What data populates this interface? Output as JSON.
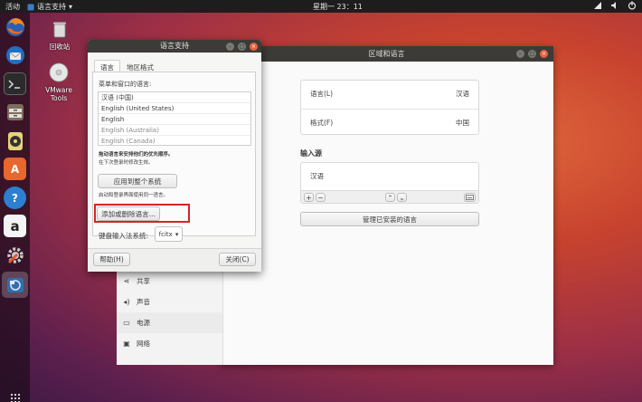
{
  "topbar": {
    "activities": "活动",
    "app_name": "语言支持",
    "app_arrow": "▾",
    "clock": "星期一 23：11",
    "tray_icons": [
      "network-icon",
      "volume-icon",
      "power-icon"
    ]
  },
  "dock": {
    "apps": [
      "firefox-icon",
      "thunderbird-icon",
      "terminal-icon",
      "files-icon",
      "rhythmbox-icon",
      "software-center-icon",
      "help-icon",
      "amazon-icon",
      "settings-icon",
      "language-support-icon"
    ],
    "amazon_label": "a",
    "help_label": "?",
    "software_label": "A"
  },
  "desktop": {
    "trash_label": "回收站",
    "vmware_label": "VMware Tools"
  },
  "region_window": {
    "title": "区域和语言",
    "language_label": "语言(L)",
    "language_value": "汉语",
    "formats_label": "格式(F)",
    "formats_value": "中国",
    "input_sources_heading": "输入源",
    "input_source_item": "汉语",
    "add_symbol": "+",
    "remove_symbol": "−",
    "up_symbol": "⌃",
    "down_symbol": "⌄",
    "manage_button": "管理已安装的语言"
  },
  "settings_list": [
    {
      "icon": "share-icon",
      "glyph": "⋖",
      "label": "共享"
    },
    {
      "icon": "sound-icon",
      "glyph": "◂)",
      "label": "声音"
    },
    {
      "icon": "power-icon",
      "glyph": "▭",
      "label": "电源"
    },
    {
      "icon": "network-icon",
      "glyph": "▣",
      "label": "网络"
    }
  ],
  "dialog": {
    "title": "语言支持",
    "tab_language": "语言",
    "tab_regional": "地区格式",
    "menus_label": "菜单和窗口的语言:",
    "languages": [
      "汉语 (中国)",
      "English (United States)",
      "English",
      "English (Australia)",
      "English (Canada)"
    ],
    "hint_bold": "拖动语言来安排他们的优先顺序。",
    "hint_sub": "在下次登录时修改生效。",
    "apply_button": "应用到整个系统",
    "apply_hint": "启动和登录界面使用同一语言。",
    "add_remove_button": "添加或删除语言...",
    "keyboard_label": "键盘输入法系统:",
    "keyboard_value": "fcitx",
    "help_button": "帮助(H)",
    "close_button": "关闭(C)"
  }
}
